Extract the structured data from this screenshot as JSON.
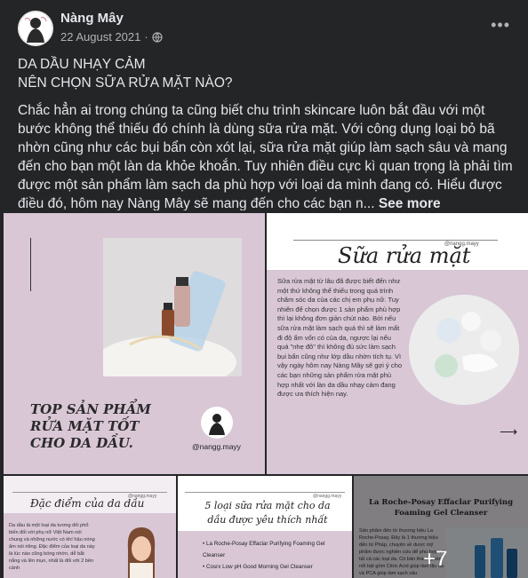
{
  "post": {
    "author": "Nàng Mây",
    "date": "22 August 2021",
    "dot": "·",
    "title_line1": "DA DẦU NHẠY CẢM",
    "title_line2": "NÊN CHỌN SỮA RỬA MẶT NÀO?",
    "body": "Chắc hẳn ai trong chúng ta cũng biết chu trình skincare luôn bắt đầu với một bước không thể thiếu đó chính là dùng sữa rửa mặt. Với công dụng loại bỏ bã nhờn cũng như các bụi bẩn còn xót lại, sữa rửa mặt giúp làm sạch sâu và mang đến cho bạn một làn da khỏe khoắn. Tuy nhiên điều cực kì quan trọng là phải tìm được một sản phẩm làm sạch da phù hợp với loại da mình đang có. Hiểu được điều đó, hôm nay Nàng Mây sẽ mang đến cho các bạn n...",
    "see_more": "See more",
    "more_icon": "•••"
  },
  "tiles": {
    "t1_title": "TOP SẢN PHẨM RỬA MẶT TỐT CHO DA DẦU.",
    "t1_handle": "@nangg.mayy",
    "t2_title": "Sữa rửa mặt",
    "t2_handle": "@nangg.mayy",
    "t2_body": "Sữa rửa mặt từ lâu đã được biết đến như một thứ không thể thiếu trong quá trình chăm sóc da của các chị em phụ nữ. Tuy nhiên để chọn được 1 sản phẩm phù hợp thì lại không đơn giản chút nào. Bởi nếu sữa rửa mặt làm sạch quá thì sẽ làm mất đi độ ẩm vốn có của da, ngược lại nếu quá \"nhẹ đô\" thì không đủ sức làm sạch bụi bẩn cũng như lớp dầu nhờn tích tụ. Vì vậy ngày hôm nay Nàng Mây sẽ gợi ý cho các bạn những sản phẩm rửa mặt phù hợp nhất với làn da dầu nhạy cảm đang được ưa thích hiện nay.",
    "t2_arrow": "⟶",
    "t3_title": "Đặc điểm của da dầu",
    "t3_handle": "@nangg.mayy",
    "t3_body": "Da dầu là một loại da tương đối phổ biến đối với phụ nữ Việt Nam nói chung và những nước có khí hậu nóng ẩm nói riêng. Đặc điểm của loại da này là lúc nào cũng bóng nhờn, dễ bắt nắng và lên mụn, nhất là đối với 2 bên cánh",
    "t4_title": "5 loại sữa rửa mặt cho da dầu được yêu thích nhất",
    "t4_handle": "@nangg.mayy",
    "t4_items": [
      "La Roche-Posay Effaclar Purifying Foaming Gel Cleanser",
      "Cosrx Low pH Good Morning Gel Cleanser"
    ],
    "t5_title": "La Roche-Posay Effaclar Purifying Foaming Gel Cleanser",
    "t5_body": "Sản phẩm đến từ thương hiệu La Roche-Posay. Đây là 1 thương hiệu đến từ Pháp, chuyên về dược mỹ phẩm được nghiên cứu để phù hợp với tất cả các loại da. Có bản thành phần nổi bật gồm Citric Acid giúp làm dịu da và PCA giúp làm sạch sâu",
    "more_count": "+7"
  },
  "colors": {
    "bg": "#242526",
    "tile_pink": "#d9c7d6",
    "text": "#e4e6eb",
    "muted": "#b0b3b8"
  }
}
